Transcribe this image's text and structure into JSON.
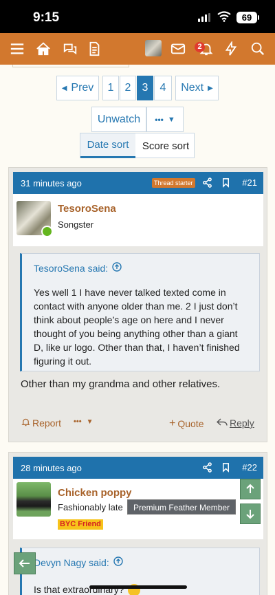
{
  "status_bar": {
    "time": "9:15",
    "battery": "69"
  },
  "nav": {
    "notification_count": "2"
  },
  "pagination": {
    "prev_label": "Prev",
    "next_label": "Next",
    "pages": [
      "1",
      "2",
      "3",
      "4"
    ],
    "current_page": "3"
  },
  "thread_tools": {
    "unwatch_label": "Unwatch",
    "more_label": "•••"
  },
  "sort": {
    "date_label": "Date sort",
    "score_label": "Score sort",
    "active": "Date sort"
  },
  "posts": [
    {
      "time": "31 minutes ago",
      "starter_tag": "Thread starter",
      "number": "#21",
      "username": "TesoroSena",
      "user_title": "Songster",
      "quote_author": "TesoroSena said:",
      "quote_text": "Yes well 1 I have never talked texted come in contact with anyone older than me. 2 I just don’t think about people’s age on here and I never thought of you being anything other than a giant D, like ur logo. Other than that, I haven’t finished figuring it out.",
      "body": "Other than my grandma and other relatives.",
      "report_label": "Report",
      "more_label": "•••",
      "quote_label": "Quote",
      "reply_label": "Reply"
    },
    {
      "time": "28 minutes ago",
      "number": "#22",
      "username": "Chicken poppy",
      "user_title": "Fashionably late",
      "premium_badge": "Premium Feather Member",
      "byc_badge": "BYC Friend",
      "quote_author": "Devyn Nagy said:",
      "quote_text": "Is that extraordinary?"
    }
  ],
  "colors": {
    "nav": "#d2782e",
    "header": "#1f72ac",
    "accent": "#2577b1",
    "username": "#a8632b",
    "vote": "#6ba27a"
  }
}
